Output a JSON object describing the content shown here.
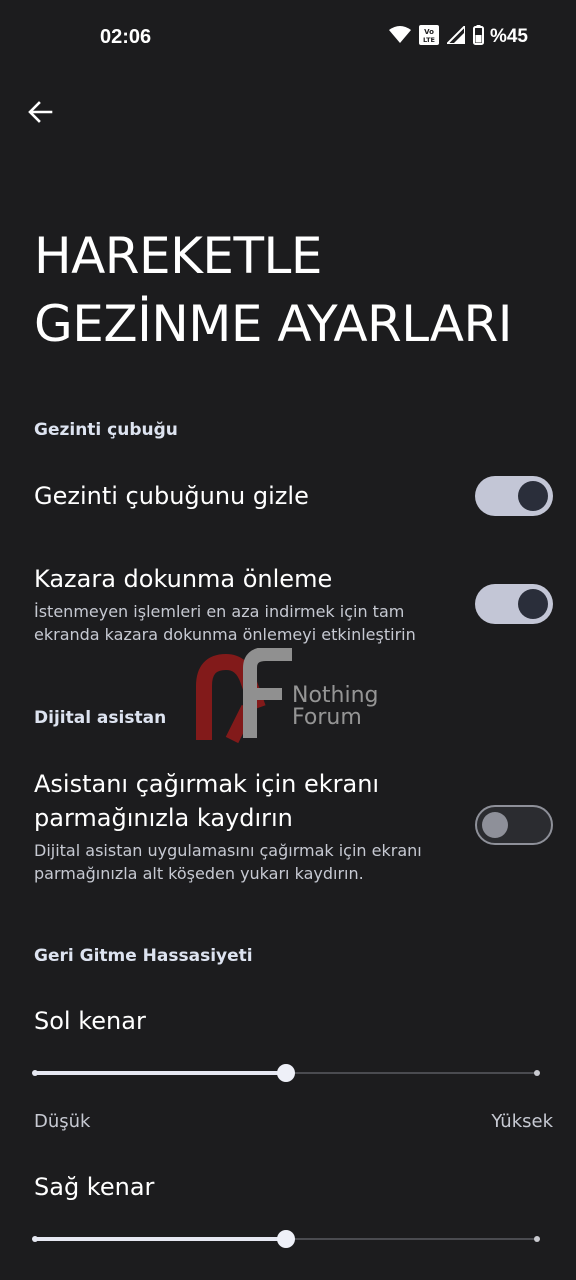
{
  "status_bar": {
    "time": "02:06",
    "battery": "%45",
    "icons": [
      "wifi-icon",
      "volte-icon",
      "signal-icon",
      "battery-icon"
    ]
  },
  "header": {
    "back_icon": "arrow-left-icon",
    "title": "HAREKETLE GEZİNME AYARLARI"
  },
  "sections": {
    "nav_bar": {
      "header": "Gezinti çubuğu",
      "hide_nav": {
        "title": "Gezinti çubuğunu gizle",
        "enabled": true
      },
      "accidental_touch": {
        "title": "Kazara dokunma önleme",
        "subtitle": "İstenmeyen işlemleri en aza indirmek için tam ekranda kazara dokunma önlemeyi etkinleştirin",
        "enabled": true
      }
    },
    "assistant": {
      "header": "Dijital asistan",
      "swipe": {
        "title": "Asistanı çağırmak için ekranı parmağınızla kaydırın",
        "subtitle": "Dijital asistan uygulamasını çağırmak için ekranı parmağınızla alt köşeden yukarı kaydırın.",
        "enabled": false
      }
    },
    "back_sensitivity": {
      "header": "Geri Gitme Hassasiyeti",
      "left_edge": {
        "title": "Sol kenar",
        "value": 0.5
      },
      "low_label": "Düşük",
      "high_label": "Yüksek",
      "right_edge": {
        "title": "Sağ kenar",
        "value": 0.5
      }
    }
  },
  "watermark": {
    "line1": "Nothing",
    "line2": "Forum"
  },
  "colors": {
    "background": "#1c1c1e",
    "switch_on_track": "#c3c6d6",
    "switch_on_knob": "#2a2e3a",
    "watermark_red": "#8b1a1a"
  }
}
